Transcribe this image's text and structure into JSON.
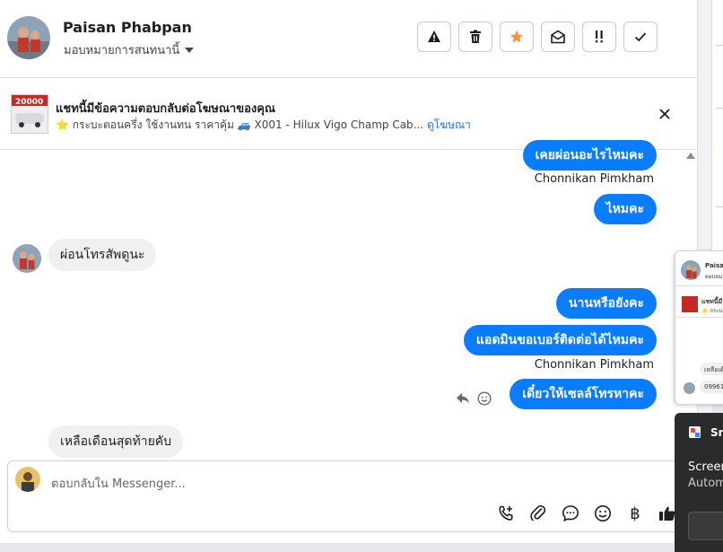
{
  "header": {
    "name": "Paisan Phabpan",
    "assign_label": "มอบหมายการสนทนานี้",
    "actions": [
      "alert-icon",
      "trash-icon",
      "star-icon",
      "envelope-open-icon",
      "important-icon",
      "check-icon"
    ],
    "star_color": "#f7923a"
  },
  "ad": {
    "title": "แชทนี้มีข้อความตอบกลับต่อโฆษณาของคุณ",
    "description": "⭐ กระบะตอนครึ่ง ใช้งานทน ราคาคุ้ม 🚙 X001 - Hilux Vigo Champ Cab...",
    "link": "ดูโฆษณา",
    "thumb_price": "20000"
  },
  "messages": {
    "m1": "เคยผ่อนอะไรไหมคะ",
    "sender1": "Chonnikan Pimkham",
    "m2": "ไหมคะ",
    "m3": "ผ่อนโทรสัพดูนะ",
    "m4": "นานหรือยังคะ",
    "m5": "แอดมินขอเบอร์ติดต่อได้ไหมคะ",
    "sender2": "Chonnikan Pimkham",
    "m6": "เดี๋ยวให้เซลล์โทรหาคะ",
    "m7": "เหลือเดือนสุดท้ายคับ"
  },
  "composer": {
    "placeholder": "ตอบกลับใน Messenger...",
    "currency": "฿"
  },
  "overlay": {
    "name": "Paisan",
    "sub": "ตอบหม",
    "ad_line": "แชทนี้มี",
    "ad_line2": "⭐ กระบะ",
    "msg_line": "เหลือเดื",
    "msg_line2": "09961",
    "snip_label": "Sn",
    "screen_label": "Screer",
    "auto_label": "Autom"
  },
  "colors": {
    "accent": "#0a7cff",
    "bubble_in": "#f0f0f0"
  }
}
